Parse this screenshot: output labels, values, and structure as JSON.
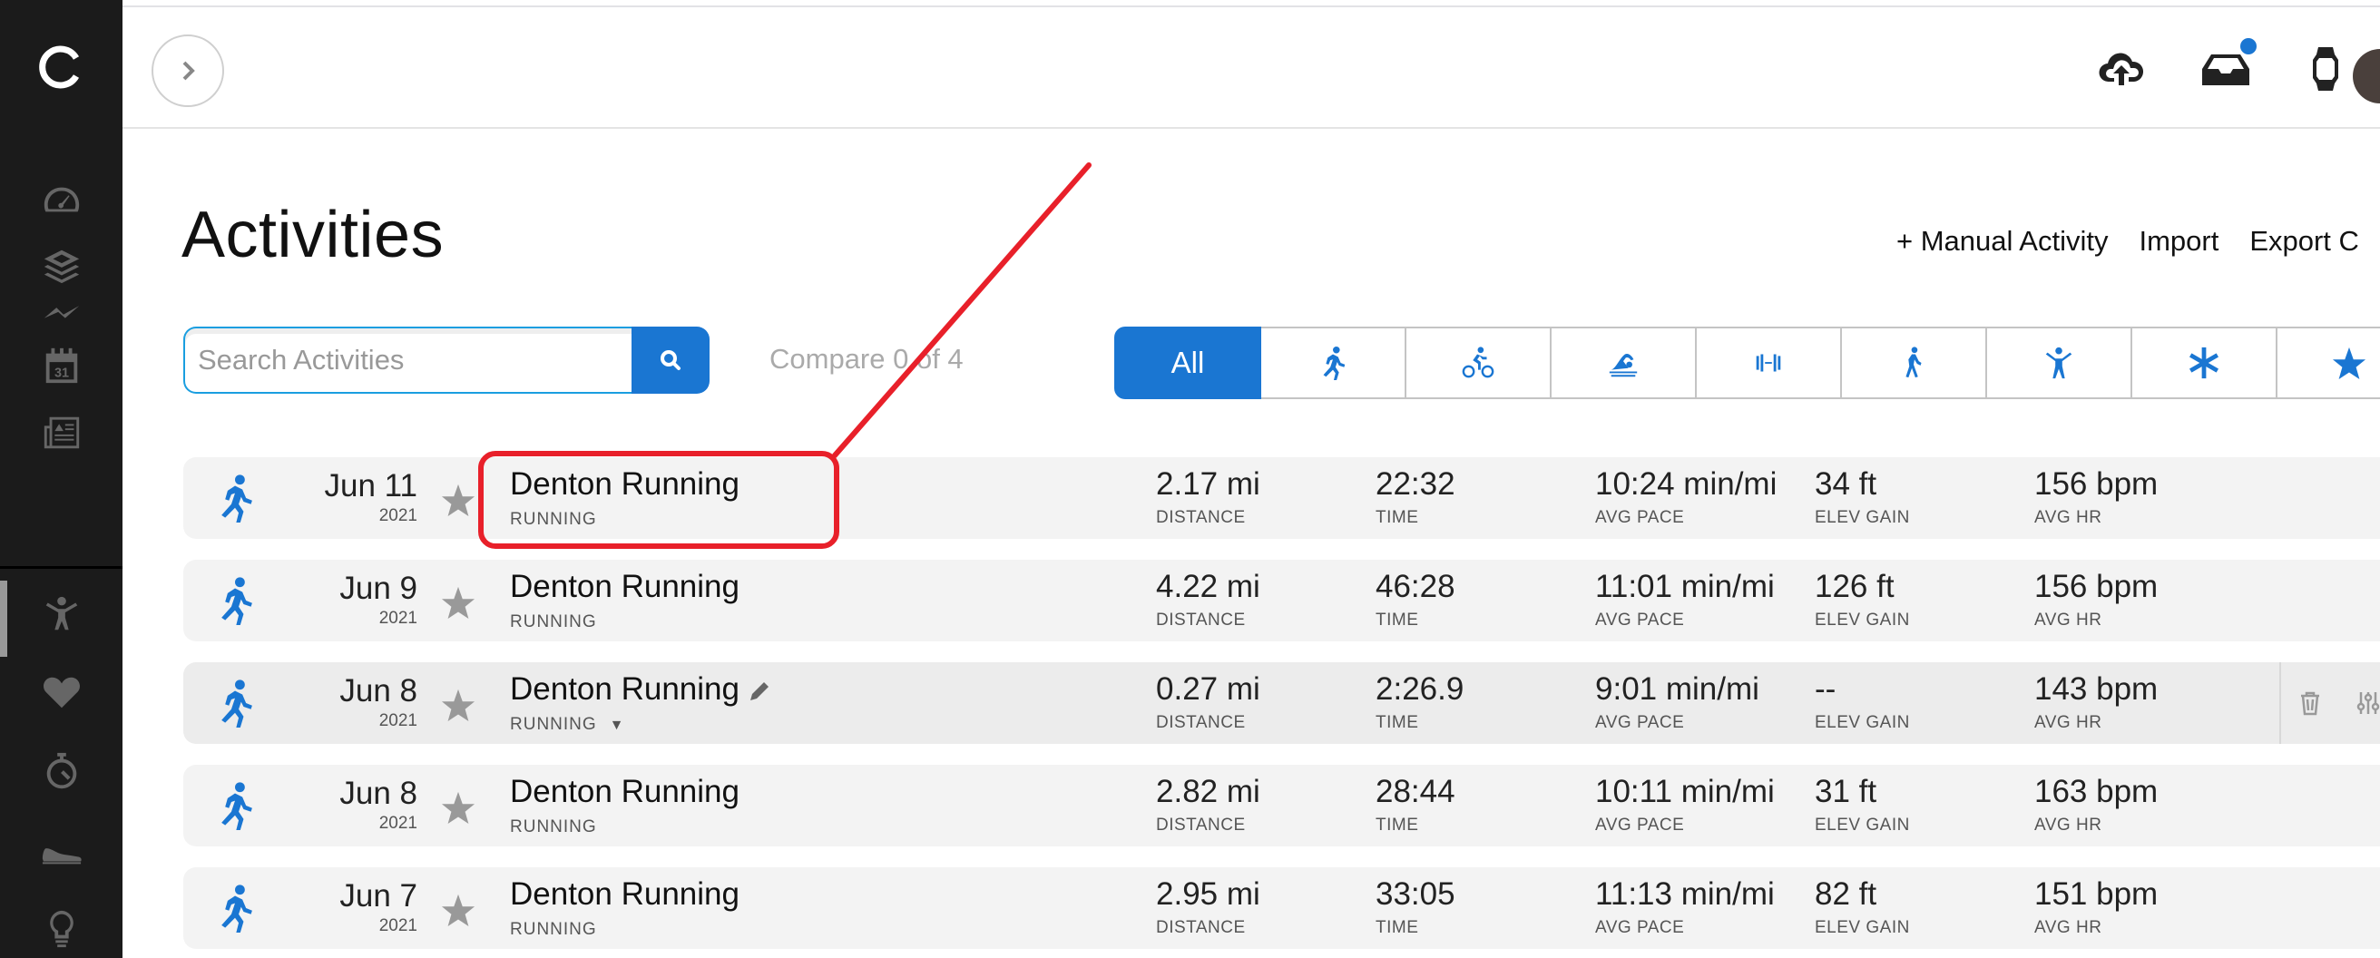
{
  "sidebar": {
    "logo": "garmin-connect-logo",
    "items": [
      {
        "name": "dashboard",
        "icon": "speedometer-icon"
      },
      {
        "name": "training",
        "icon": "layers-icon"
      },
      {
        "name": "insights",
        "icon": "trend-line-icon"
      },
      {
        "name": "calendar",
        "icon": "calendar-icon",
        "label": "31"
      },
      {
        "name": "news",
        "icon": "newspaper-icon"
      },
      {
        "name": "activities",
        "icon": "person-arms-up-icon",
        "active": true
      },
      {
        "name": "health-stats",
        "icon": "heart-icon"
      },
      {
        "name": "performance-stats",
        "icon": "stopwatch-icon"
      },
      {
        "name": "gear",
        "icon": "shoe-icon"
      },
      {
        "name": "insights-tips",
        "icon": "lightbulb-icon"
      }
    ]
  },
  "header": {
    "expand_icon": "chevron-right-icon",
    "icons": [
      "cloud-upload-icon",
      "inbox-icon",
      "watch-icon"
    ],
    "inbox_has_notification": true,
    "accent_color": "#1a76d2"
  },
  "page": {
    "title": "Activities",
    "actions": [
      "+ Manual Activity",
      "Import",
      "Export C"
    ]
  },
  "search": {
    "placeholder": "Search Activities",
    "value": "",
    "compare_text": "Compare 0 of 4"
  },
  "filters": {
    "active": "All",
    "tabs": [
      {
        "label": "All",
        "icon": null
      },
      {
        "label": "Running",
        "icon": "running-icon"
      },
      {
        "label": "Cycling",
        "icon": "cycling-icon"
      },
      {
        "label": "Swimming",
        "icon": "swimming-icon"
      },
      {
        "label": "Strength",
        "icon": "dumbbell-icon"
      },
      {
        "label": "Walking",
        "icon": "walking-icon"
      },
      {
        "label": "Fitness",
        "icon": "person-arms-up-icon"
      },
      {
        "label": "Other",
        "icon": "asterisk-icon"
      },
      {
        "label": "Favorites",
        "icon": "star-icon"
      }
    ]
  },
  "metric_labels": {
    "distance": "DISTANCE",
    "time": "TIME",
    "pace": "AVG PACE",
    "elev": "ELEV GAIN",
    "hr": "AVG HR"
  },
  "activities": [
    {
      "date": "Jun 11",
      "year": "2021",
      "name": "Denton Running",
      "type": "RUNNING",
      "distance": "2.17 mi",
      "time": "22:32",
      "pace": "10:24 min/mi",
      "elev": "34 ft",
      "hr": "156 bpm",
      "highlighted": true
    },
    {
      "date": "Jun 9",
      "year": "2021",
      "name": "Denton Running",
      "type": "RUNNING",
      "distance": "4.22 mi",
      "time": "46:28",
      "pace": "11:01 min/mi",
      "elev": "126 ft",
      "hr": "156 bpm"
    },
    {
      "date": "Jun 8",
      "year": "2021",
      "name": "Denton Running",
      "type": "RUNNING",
      "distance": "0.27 mi",
      "time": "2:26.9",
      "pace": "9:01 min/mi",
      "elev": "--",
      "hr": "143 bpm",
      "hovered": true
    },
    {
      "date": "Jun 8",
      "year": "2021",
      "name": "Denton Running",
      "type": "RUNNING",
      "distance": "2.82 mi",
      "time": "28:44",
      "pace": "10:11 min/mi",
      "elev": "31 ft",
      "hr": "163 bpm"
    },
    {
      "date": "Jun 7",
      "year": "2021",
      "name": "Denton Running",
      "type": "RUNNING",
      "distance": "2.95 mi",
      "time": "33:05",
      "pace": "11:13 min/mi",
      "elev": "82 ft",
      "hr": "151 bpm"
    }
  ],
  "annotation": {
    "color": "#e8202a",
    "target": "activity-name-first-row"
  }
}
